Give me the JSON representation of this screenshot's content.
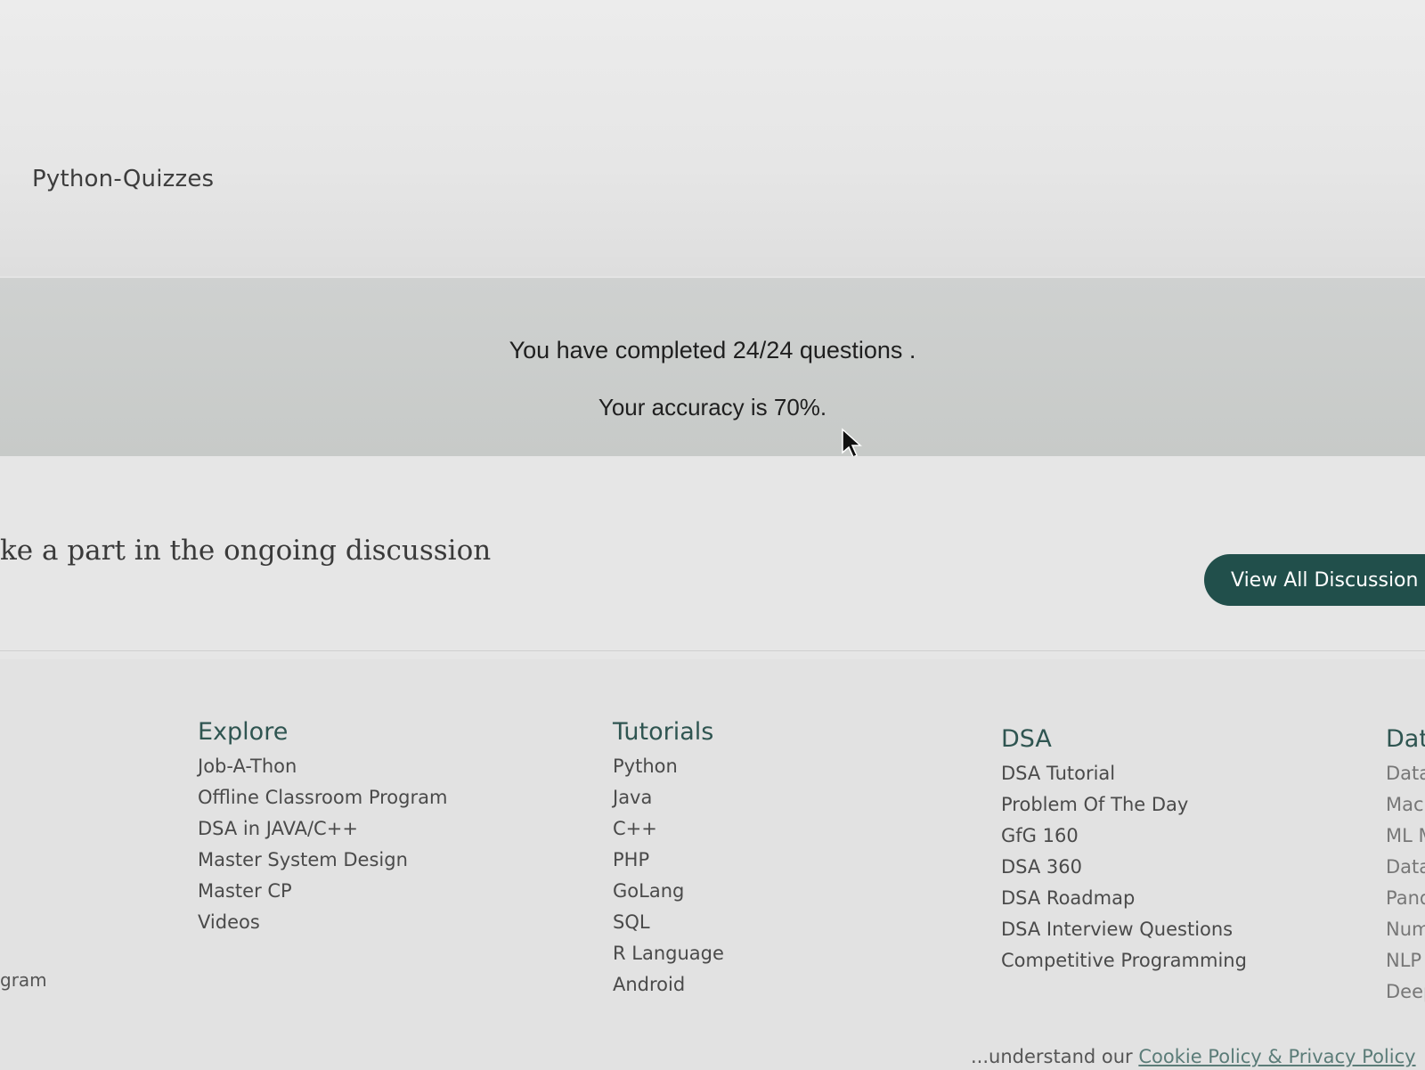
{
  "breadcrumb": "Python-Quizzes",
  "result": {
    "completed_text": "You have completed 24/24 questions .",
    "accuracy_text": "Your accuracy is 70%."
  },
  "discussion": {
    "prompt": "ke a part in the ongoing discussion",
    "button_label": "View All Discussion"
  },
  "footer": {
    "explore": {
      "heading": "Explore",
      "links": [
        "Job-A-Thon",
        "Offline Classroom Program",
        "DSA in JAVA/C++",
        "Master System Design",
        "Master CP",
        "Videos"
      ]
    },
    "tutorials": {
      "heading": "Tutorials",
      "links": [
        "Python",
        "Java",
        "C++",
        "PHP",
        "GoLang",
        "SQL",
        "R Language",
        "Android"
      ]
    },
    "dsa": {
      "heading": "DSA",
      "links": [
        "DSA Tutorial",
        "Problem Of The Day",
        "GfG 160",
        "DSA 360",
        "DSA Roadmap",
        "DSA Interview Questions",
        "Competitive Programming"
      ]
    },
    "data": {
      "heading": "Dat",
      "links": [
        "Data",
        "Mach",
        "ML M",
        "Data",
        "Panda",
        "NumP",
        "NLP",
        "Deep L"
      ]
    },
    "partial_left": "gram",
    "cookie_prefix": "...understand our ",
    "cookie_link": "Cookie Policy & Privacy Policy"
  },
  "colors": {
    "accent": "#214f4b",
    "heading": "#2f5551"
  }
}
